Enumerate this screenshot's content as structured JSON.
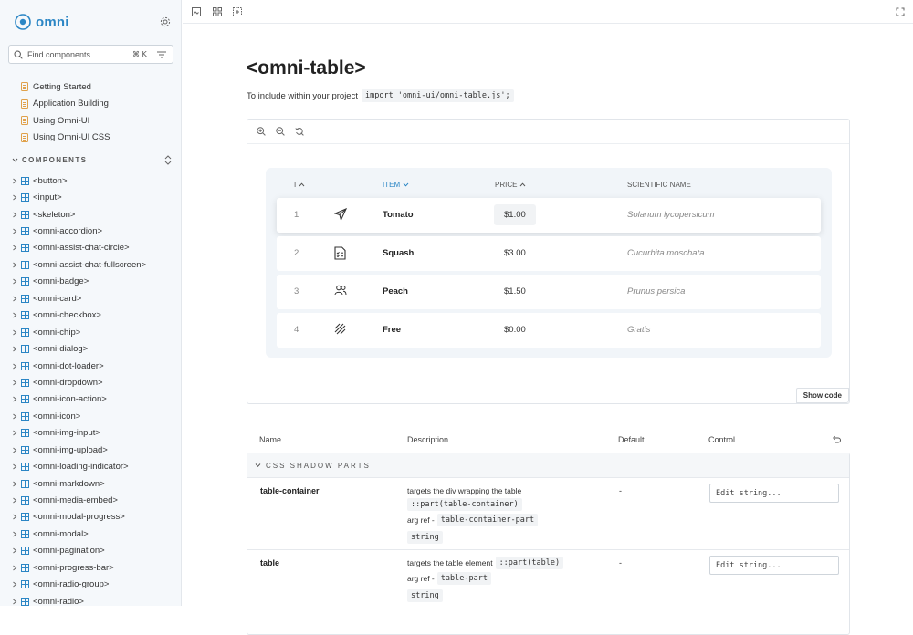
{
  "app": {
    "name": "omni",
    "accent": "#2b86c5"
  },
  "search": {
    "placeholder": "Find components",
    "shortcut": "⌘ K"
  },
  "docs": [
    {
      "label": "Getting Started"
    },
    {
      "label": "Application Building"
    },
    {
      "label": "Using Omni-UI"
    },
    {
      "label": "Using Omni-UI CSS"
    }
  ],
  "components_section": {
    "label": "COMPONENTS"
  },
  "components": [
    "<button>",
    "<input>",
    "<skeleton>",
    "<omni-accordion>",
    "<omni-assist-chat-circle>",
    "<omni-assist-chat-fullscreen>",
    "<omni-badge>",
    "<omni-card>",
    "<omni-checkbox>",
    "<omni-chip>",
    "<omni-dialog>",
    "<omni-dot-loader>",
    "<omni-dropdown>",
    "<omni-icon-action>",
    "<omni-icon>",
    "<omni-img-input>",
    "<omni-img-upload>",
    "<omni-loading-indicator>",
    "<omni-markdown>",
    "<omni-media-embed>",
    "<omni-modal-progress>",
    "<omni-modal>",
    "<omni-pagination>",
    "<omni-progress-bar>",
    "<omni-radio-group>",
    "<omni-radio>"
  ],
  "page": {
    "title": "<omni-table>",
    "include_text": "To include within your project",
    "include_code": "import 'omni-ui/omni-table.js';"
  },
  "table": {
    "headers": {
      "index": "I",
      "item": "ITEM",
      "price": "PRICE",
      "sci": "SCIENTIFIC NAME"
    },
    "rows": [
      {
        "index": "1",
        "icon": "paper-plane-icon",
        "item": "Tomato",
        "price": "$1.00",
        "sci": "Solanum lycopersicum"
      },
      {
        "index": "2",
        "icon": "checklist-icon",
        "item": "Squash",
        "price": "$3.00",
        "sci": "Cucurbita moschata"
      },
      {
        "index": "3",
        "icon": "users-icon",
        "item": "Peach",
        "price": "$1.50",
        "sci": "Prunus persica"
      },
      {
        "index": "4",
        "icon": "hatch-icon",
        "item": "Free",
        "price": "$0.00",
        "sci": "Gratis"
      }
    ]
  },
  "show_code": "Show code",
  "props": {
    "headers": {
      "name": "Name",
      "description": "Description",
      "default": "Default",
      "control": "Control"
    },
    "section": "CSS SHADOW PARTS",
    "rows": [
      {
        "name": "table-container",
        "desc": "targets the div wrapping the table",
        "part": "::part(table-container)",
        "argref_label": "arg ref -",
        "argref": "table-container-part",
        "type": "string",
        "default": "-",
        "placeholder": "Edit string..."
      },
      {
        "name": "table",
        "desc": "targets the table element",
        "part": "::part(table)",
        "argref_label": "arg ref -",
        "argref": "table-part",
        "type": "string",
        "default": "-",
        "placeholder": "Edit string..."
      }
    ]
  }
}
